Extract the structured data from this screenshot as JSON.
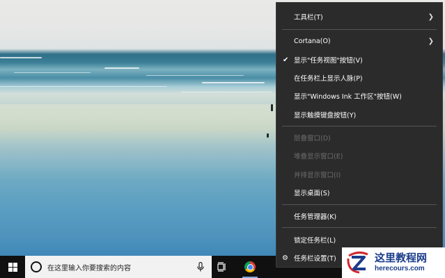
{
  "taskbar": {
    "search_placeholder": "在这里输入你要搜索的内容"
  },
  "context_menu": {
    "items": [
      {
        "label": "工具栏(T)",
        "has_submenu": true,
        "checked": false,
        "disabled": false
      },
      {
        "label": "Cortana(O)",
        "has_submenu": true,
        "checked": false,
        "disabled": false
      },
      {
        "label": "显示\"任务视图\"按钮(V)",
        "has_submenu": false,
        "checked": true,
        "disabled": false
      },
      {
        "label": "在任务栏上显示人脉(P)",
        "has_submenu": false,
        "checked": false,
        "disabled": false
      },
      {
        "label": "显示\"Windows Ink 工作区\"按钮(W)",
        "has_submenu": false,
        "checked": false,
        "disabled": false
      },
      {
        "label": "显示触摸键盘按钮(Y)",
        "has_submenu": false,
        "checked": false,
        "disabled": false
      },
      {
        "label": "层叠窗口(D)",
        "has_submenu": false,
        "checked": false,
        "disabled": true
      },
      {
        "label": "堆叠显示窗口(E)",
        "has_submenu": false,
        "checked": false,
        "disabled": true
      },
      {
        "label": "并排显示窗口(I)",
        "has_submenu": false,
        "checked": false,
        "disabled": true
      },
      {
        "label": "显示桌面(S)",
        "has_submenu": false,
        "checked": false,
        "disabled": false
      },
      {
        "label": "任务管理器(K)",
        "has_submenu": false,
        "checked": false,
        "disabled": false
      },
      {
        "label": "锁定任务栏(L)",
        "has_submenu": false,
        "checked": false,
        "disabled": false
      },
      {
        "label": "任务栏设置(T)",
        "has_submenu": false,
        "checked": false,
        "disabled": false,
        "icon": "gear-icon"
      }
    ]
  },
  "watermark": {
    "title": "这里教程网",
    "url": "herecours.com"
  },
  "colors": {
    "menu_bg": "#2b2b2b",
    "taskbar_bg": "#101010",
    "disabled_text": "#6d6d6d",
    "watermark_blue": "#1b3b8a",
    "watermark_red": "#d4262e"
  }
}
